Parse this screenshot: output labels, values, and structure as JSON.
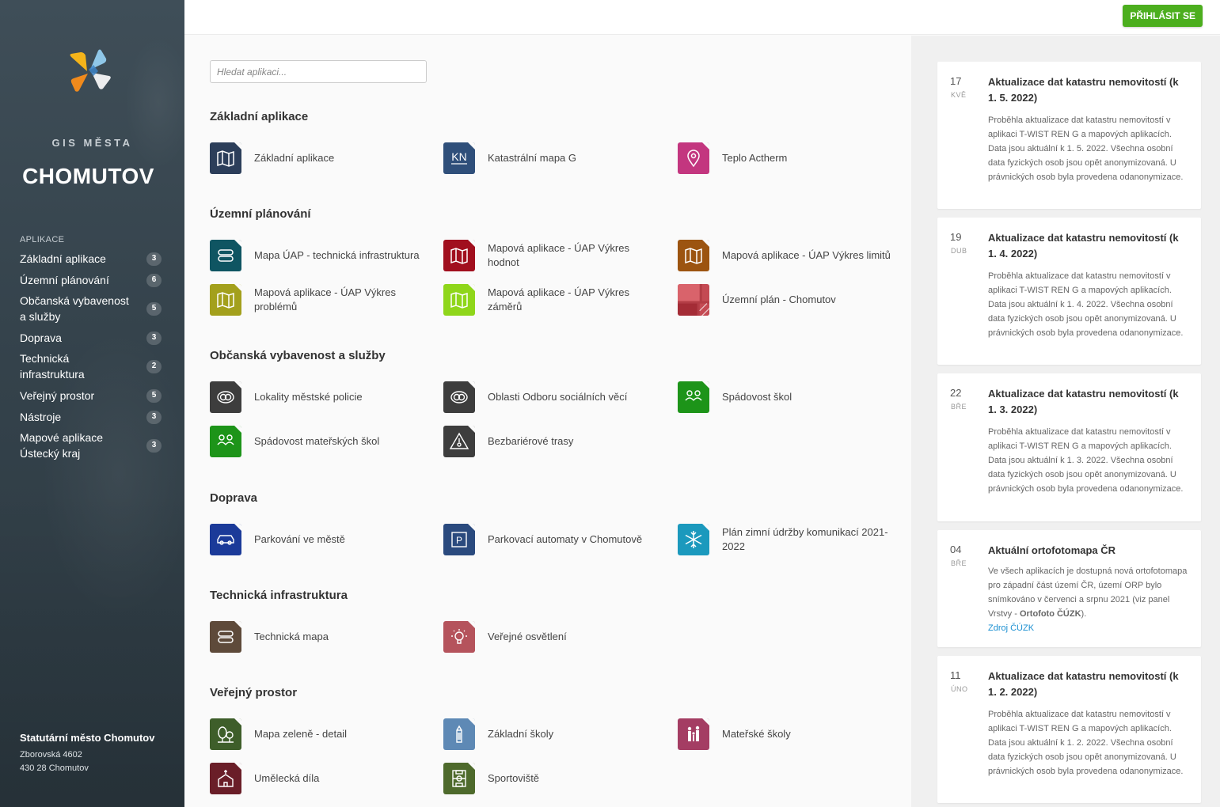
{
  "sidebar": {
    "brand_sub": "GIS MĚSTA",
    "brand_title": "CHOMUTOV",
    "nav_heading": "APLIKACE",
    "items": [
      {
        "label": "Základní aplikace",
        "count": "3"
      },
      {
        "label": "Územní plánování",
        "count": "6"
      },
      {
        "label": "Občanská vybavenost a služby",
        "count": "5"
      },
      {
        "label": "Doprava",
        "count": "3"
      },
      {
        "label": "Technická infrastruktura",
        "count": "2"
      },
      {
        "label": "Veřejný prostor",
        "count": "5"
      },
      {
        "label": "Nástroje",
        "count": "3"
      },
      {
        "label": "Mapové aplikace Ústecký kraj",
        "count": "3"
      }
    ],
    "org_name": "Statutární město Chomutov",
    "org_street": "Zborovská 4602",
    "org_city": "430 28 Chomutov"
  },
  "header": {
    "login_label": "PŘIHLÁSIT SE",
    "login_color": "#4cae1e"
  },
  "search": {
    "placeholder": "Hledat aplikaci..."
  },
  "sections": [
    {
      "title": "Základní aplikace",
      "apps": [
        {
          "label": "Základní aplikace",
          "icon": "map-icon",
          "color": "#2c3e5a"
        },
        {
          "label": "Katastrální mapa G",
          "icon": "kn-icon",
          "color": "#2f4f7a"
        },
        {
          "label": "Teplo Actherm",
          "icon": "map-pin-icon",
          "color": "#c3367f"
        }
      ]
    },
    {
      "title": "Územní plánování",
      "apps": [
        {
          "label": "Mapa ÚAP - technická infrastruktura",
          "icon": "pipes-icon",
          "color": "#0f5562"
        },
        {
          "label": "Mapová aplikace - ÚAP Výkres hodnot",
          "icon": "map-icon",
          "color": "#a10f1e"
        },
        {
          "label": "Mapová aplikace - ÚAP Výkres limitů",
          "icon": "map-icon",
          "color": "#9c5410"
        },
        {
          "label": "Mapová aplikace - ÚAP Výkres problémů",
          "icon": "map-icon",
          "color": "#a3a01c"
        },
        {
          "label": "Mapová aplikace - ÚAP Výkres záměrů",
          "icon": "map-icon",
          "color": "#8fd61a"
        },
        {
          "label": "Územní plán - Chomutov",
          "icon": "zoning-plan-icon",
          "color": "#b33d46"
        }
      ]
    },
    {
      "title": "Občanská vybavenost a služby",
      "apps": [
        {
          "label": "Lokality městské policie",
          "icon": "police-icon",
          "color": "#3d3d3d"
        },
        {
          "label": "Oblasti Odboru sociálních věcí",
          "icon": "police-icon",
          "color": "#3d3d3d"
        },
        {
          "label": "Spádovost škol",
          "icon": "people-icon",
          "color": "#1d9419"
        },
        {
          "label": "Spádovost mateřských škol",
          "icon": "people-icon",
          "color": "#1d9419"
        },
        {
          "label": "Bezbariérové trasy",
          "icon": "warning-icon",
          "color": "#3d3d3d"
        }
      ]
    },
    {
      "title": "Doprava",
      "apps": [
        {
          "label": "Parkování ve městě",
          "icon": "car-icon",
          "color": "#1b3a99"
        },
        {
          "label": "Parkovací automaty v Chomutově",
          "icon": "parking-icon",
          "color": "#2a4a7e"
        },
        {
          "label": "Plán zimní údržby komunikací 2021-2022",
          "icon": "snowflake-icon",
          "color": "#1b99bd"
        }
      ]
    },
    {
      "title": "Technická infrastruktura",
      "apps": [
        {
          "label": "Technická mapa",
          "icon": "pipes-icon",
          "color": "#5e4a3a"
        },
        {
          "label": "Veřejné osvětlení",
          "icon": "lightbulb-icon",
          "color": "#b5535c"
        }
      ]
    },
    {
      "title": "Veřejný prostor",
      "apps": [
        {
          "label": "Mapa zeleně - detail",
          "icon": "trees-icon",
          "color": "#3e5e2a"
        },
        {
          "label": "Základní školy",
          "icon": "pencil-icon",
          "color": "#5e89b5"
        },
        {
          "label": "Mateřské školy",
          "icon": "family-icon",
          "color": "#a43d63"
        },
        {
          "label": "Umělecká díla",
          "icon": "church-icon",
          "color": "#6a1e28"
        },
        {
          "label": "Sportoviště",
          "icon": "field-icon",
          "color": "#4e6a2c"
        }
      ]
    }
  ],
  "news": [
    {
      "day": "17",
      "month": "KVĚ",
      "title": "Aktualizace dat katastru nemovitostí (k 1. 5. 2022)",
      "text": "Proběhla aktualizace dat katastru nemovitostí v aplikaci T-WIST REN G a mapových aplikacích. Data jsou aktuální k 1. 5. 2022. Všechna osobní data fyzických osob jsou opět anonymizovaná. U právnických osob byla provedena odanonymizace."
    },
    {
      "day": "19",
      "month": "DUB",
      "title": "Aktualizace dat katastru nemovitostí (k 1. 4. 2022)",
      "text": "Proběhla aktualizace dat katastru nemovitostí v aplikaci T-WIST REN G a mapových aplikacích. Data jsou aktuální k 1. 4. 2022. Všechna osobní data fyzických osob jsou opět anonymizovaná. U právnických osob byla provedena odanonymizace."
    },
    {
      "day": "22",
      "month": "BŘE",
      "title": "Aktualizace dat katastru nemovitostí (k 1. 3. 2022)",
      "text": "Proběhla aktualizace dat katastru nemovitostí v aplikaci T-WIST REN G a mapových aplikacích. Data jsou aktuální k 1. 3. 2022. Všechna osobní data fyzických osob jsou opět anonymizovaná. U právnických osob byla provedena odanonymizace."
    },
    {
      "day": "04",
      "month": "BŘE",
      "title": "Aktuální ortofotomapa ČR",
      "text_before": "Ve všech aplikacích je dostupná nová ortofotomapa pro západní část území ČR, území ORP bylo snímkováno v červenci a srpnu 2021 (viz panel Vrstvy - ",
      "text_bold": "Ortofoto ČÚZK",
      "text_after": ").",
      "link": "Zdroj ČÚZK"
    },
    {
      "day": "11",
      "month": "ÚNO",
      "title": "Aktualizace dat katastru nemovitostí (k 1. 2. 2022)",
      "text": "Proběhla aktualizace dat katastru nemovitostí v aplikaci T-WIST REN G a mapových aplikacích. Data jsou aktuální k 1. 2. 2022. Všechna osobní data fyzických osob jsou opět anonymizovaná. U právnických osob byla provedena odanonymizace."
    }
  ]
}
